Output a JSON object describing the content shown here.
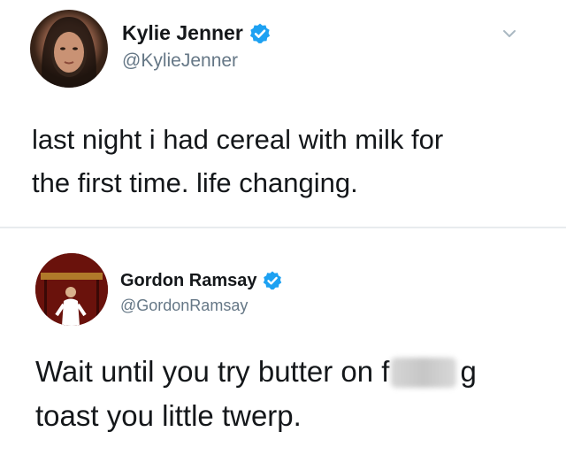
{
  "tweets": [
    {
      "display_name": "Kylie Jenner",
      "handle": "@KylieJenner",
      "verified": true,
      "text_lines": [
        "last night i had cereal with milk for",
        "the first time. life changing."
      ]
    },
    {
      "display_name": "Gordon Ramsay",
      "handle": "@GordonRamsay",
      "verified": true,
      "text_line_1_before": "Wait until you try butter on f",
      "text_line_1_after": "g",
      "text_line_2": "toast you little twerp."
    }
  ],
  "icons": {
    "verified": "verified-badge-icon",
    "caret": "chevron-down-icon"
  },
  "colors": {
    "verified_blue": "#1da1f2",
    "handle_gray": "#657786",
    "text": "#14171a"
  }
}
